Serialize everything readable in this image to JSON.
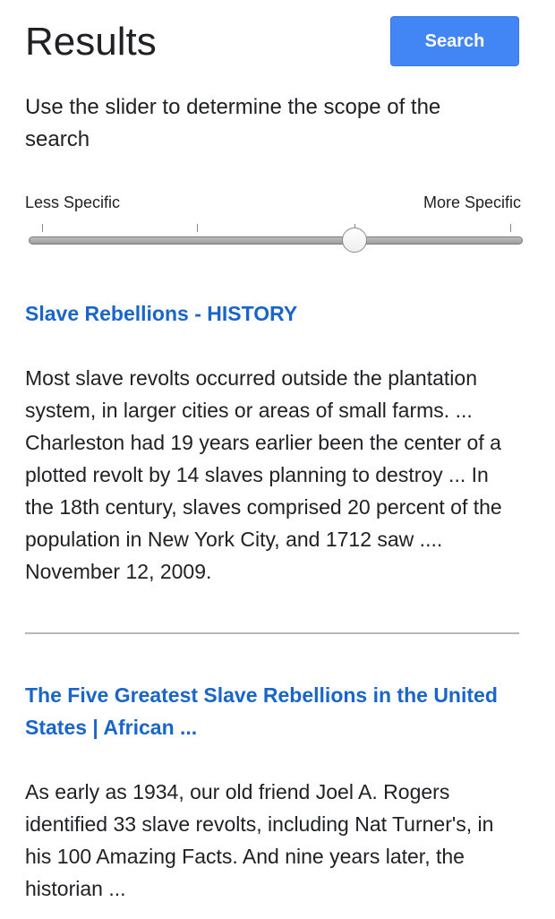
{
  "header": {
    "title": "Results",
    "search_label": "Search"
  },
  "instructions": "Use the slider to determine the scope of the search",
  "slider": {
    "left_label": "Less Specific",
    "right_label": "More Specific",
    "tick_count": 4,
    "value": 0.66
  },
  "results": [
    {
      "title": "Slave Rebellions - HISTORY",
      "snippet": "Most slave revolts occurred outside the plantation system, in larger cities or areas of small farms. ... Charleston had 19 years earlier been the center of a plotted revolt by 14 slaves planning to destroy ... In the 18th century, slaves comprised 20 percent of the population in New York City, and 1712 saw .... November 12, 2009."
    },
    {
      "title": "The Five Greatest Slave Rebellions in the United States | African ...",
      "snippet": "As early as 1934, our old friend Joel A. Rogers identified 33 slave revolts, including Nat Turner's, in his 100 Amazing Facts. And nine years later, the historian ..."
    }
  ],
  "colors": {
    "accent": "#4285f4",
    "link": "#1a66c8",
    "text": "#202124"
  }
}
